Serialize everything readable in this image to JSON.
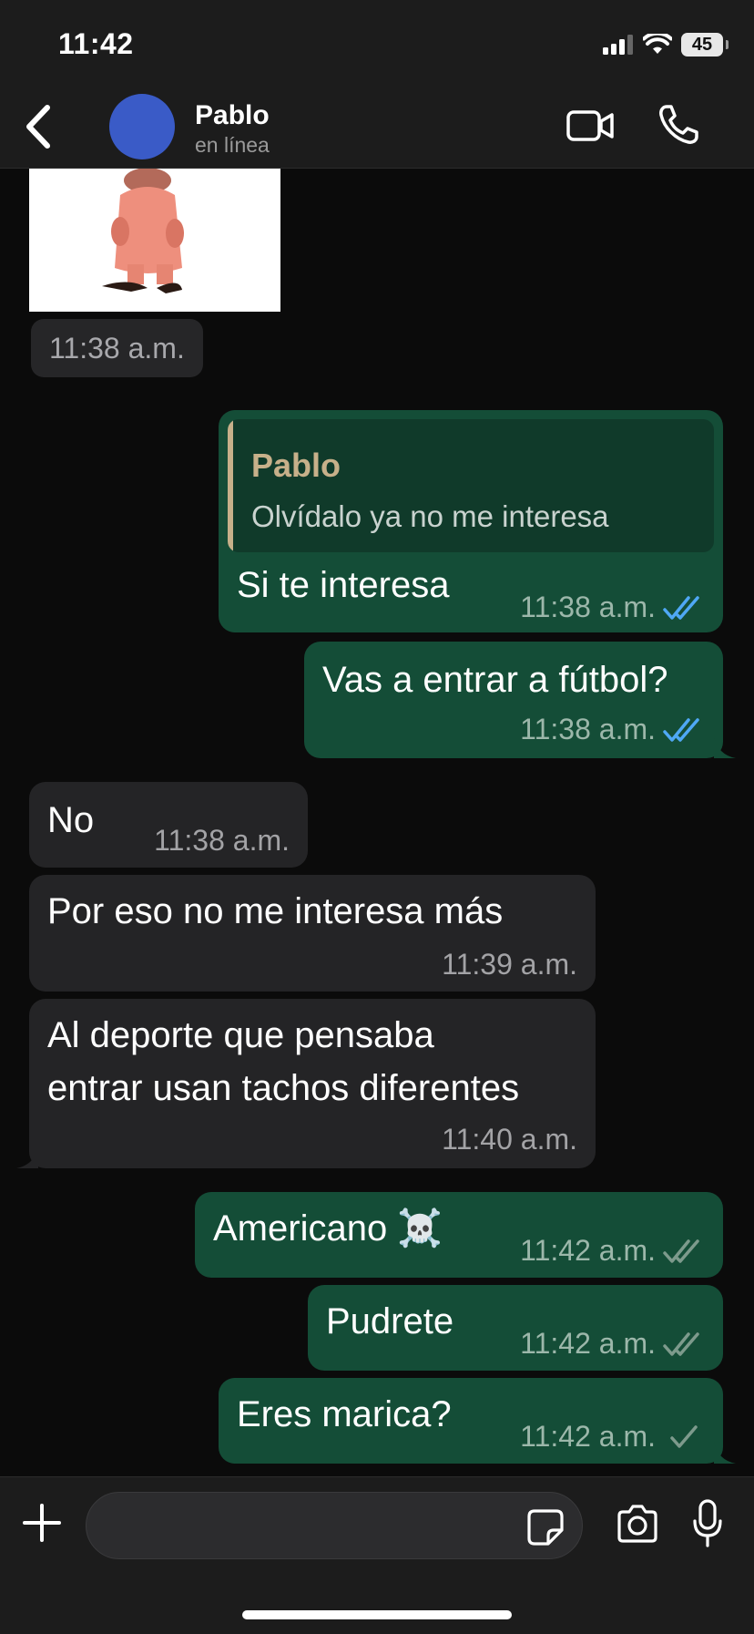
{
  "status_bar": {
    "time": "11:42",
    "battery": "45"
  },
  "header": {
    "contact_name": "Pablo",
    "contact_status": "en línea"
  },
  "sticker_message": {
    "time": "11:38 a.m."
  },
  "messages": [
    {
      "direction": "out",
      "quote_author": "Pablo",
      "quote_text": "Olvídalo ya no me interesa",
      "text": "Si te interesa",
      "time": "11:38 a.m.",
      "status": "read"
    },
    {
      "direction": "out",
      "text": "Vas a entrar a fútbol?",
      "time": "11:38 a.m.",
      "status": "read"
    },
    {
      "direction": "in",
      "text": "No",
      "time": "11:38 a.m."
    },
    {
      "direction": "in",
      "text": "Por eso no me interesa más",
      "time": "11:39 a.m."
    },
    {
      "direction": "in",
      "lines": [
        "Al deporte que pensaba",
        "entrar usan tachos diferentes"
      ],
      "time": "11:40 a.m."
    },
    {
      "direction": "out",
      "text": "Americano ☠️",
      "time": "11:42 a.m.",
      "status": "delivered"
    },
    {
      "direction": "out",
      "text": "Pudrete",
      "time": "11:42 a.m.",
      "status": "delivered"
    },
    {
      "direction": "out",
      "text": "Eres marica?",
      "time": "11:42 a.m.",
      "status": "sent"
    }
  ],
  "composer": {
    "placeholder": ""
  },
  "colors": {
    "outgoing_bubble": "#144d37",
    "incoming_bubble": "#242426",
    "read_tick": "#4fa8f5",
    "quote_author": "#c7b08a"
  }
}
